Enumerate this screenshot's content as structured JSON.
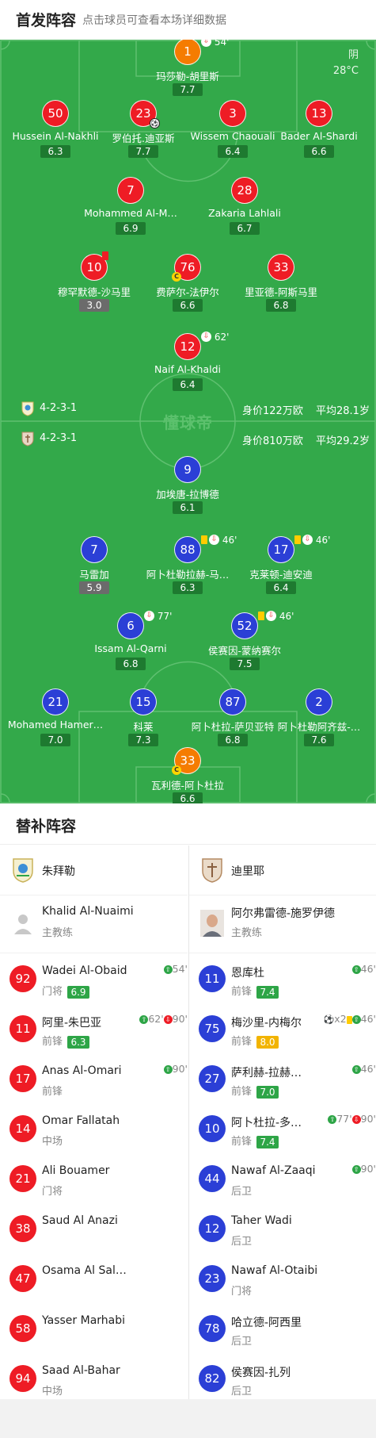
{
  "header": {
    "title": "首发阵容",
    "subtitle": "点击球员可查看本场详细数据"
  },
  "weather": {
    "condition": "阴",
    "temp": "28°C"
  },
  "watermark": "懂球帝",
  "home_team": {
    "formation": "4-2-3-1",
    "value": "身价122万欧",
    "age": "平均28.1岁"
  },
  "away_team": {
    "formation": "4-2-3-1",
    "value": "身价810万欧",
    "age": "平均29.2岁"
  },
  "home_players": [
    {
      "num": "1",
      "name": "玛莎勒-胡里斯",
      "rating": "7.7",
      "color": "orange",
      "sub": "54'"
    },
    {
      "num": "50",
      "name": "Hussein Al-Nakhli",
      "rating": "6.3",
      "color": "red"
    },
    {
      "num": "23",
      "name": "罗伯托.迪亚斯",
      "rating": "7.7",
      "color": "red",
      "goal": "⚽"
    },
    {
      "num": "3",
      "name": "Wissem Chaouali",
      "rating": "6.4",
      "color": "red"
    },
    {
      "num": "13",
      "name": "Bader Al-Shardi",
      "rating": "6.6",
      "color": "red"
    },
    {
      "num": "7",
      "name": "Mohammed Al-M…",
      "rating": "6.9",
      "color": "red"
    },
    {
      "num": "28",
      "name": "Zakaria Lahlali",
      "rating": "6.7",
      "color": "red"
    },
    {
      "num": "10",
      "name": "穆罕默德-沙马里",
      "rating": "3.0",
      "color": "red",
      "card": "red"
    },
    {
      "num": "76",
      "name": "费萨尔-法伊尔",
      "rating": "6.6",
      "color": "red",
      "captain": "C"
    },
    {
      "num": "33",
      "name": "里亚德-阿斯马里",
      "rating": "6.8",
      "color": "red"
    },
    {
      "num": "12",
      "name": "Naif Al-Khaldi",
      "rating": "6.4",
      "color": "red",
      "sub": "62'"
    }
  ],
  "away_players": [
    {
      "num": "9",
      "name": "加埃唐-拉博德",
      "rating": "6.1",
      "color": "blue"
    },
    {
      "num": "7",
      "name": "马雷加",
      "rating": "5.9",
      "color": "blue"
    },
    {
      "num": "88",
      "name": "阿卜杜勒拉赫-马…",
      "rating": "6.3",
      "color": "blue",
      "sub": "46'",
      "yellow": true
    },
    {
      "num": "17",
      "name": "克莱顿-迪安迪",
      "rating": "6.4",
      "color": "blue",
      "sub": "46'",
      "yellow": true
    },
    {
      "num": "6",
      "name": "Issam Al-Qarni",
      "rating": "6.8",
      "color": "blue",
      "sub": "77'"
    },
    {
      "num": "52",
      "name": "侯赛因-蒙纳赛尔",
      "rating": "7.5",
      "color": "blue",
      "sub": "46'",
      "yellow": true
    },
    {
      "num": "21",
      "name": "Mohamed Hamer…",
      "rating": "7.0",
      "color": "blue"
    },
    {
      "num": "15",
      "name": "科莱",
      "rating": "7.3",
      "color": "blue"
    },
    {
      "num": "87",
      "name": "阿卜杜拉-萨贝亚特",
      "rating": "6.8",
      "color": "blue"
    },
    {
      "num": "2",
      "name": "阿卜杜勒阿齐兹-…",
      "rating": "7.6",
      "color": "blue"
    },
    {
      "num": "33",
      "name": "瓦利德-阿卜杜拉",
      "rating": "6.6",
      "color": "orange",
      "captain": "C"
    }
  ],
  "subs_title": "替补阵容",
  "subs_left": {
    "team": "朱拜勒",
    "coach": {
      "name": "Khalid Al-Nuaimi",
      "role": "主教练"
    },
    "players": [
      {
        "num": "92",
        "name": "Wadei Al-Obaid",
        "pos": "门将",
        "rating": "6.9",
        "events": [
          {
            "t": "in",
            "v": "54'"
          }
        ]
      },
      {
        "num": "11",
        "name": "阿里-朱巴亚",
        "pos": "前锋",
        "rating": "6.3",
        "events": [
          {
            "t": "in",
            "v": "62'"
          },
          {
            "t": "out",
            "v": "90'"
          }
        ]
      },
      {
        "num": "17",
        "name": "Anas Al-Omari",
        "pos": "前锋",
        "events": [
          {
            "t": "in",
            "v": "90'"
          }
        ]
      },
      {
        "num": "14",
        "name": "Omar Fallatah",
        "pos": "中场",
        "events": []
      },
      {
        "num": "21",
        "name": "Ali Bouamer",
        "pos": "门将",
        "events": []
      },
      {
        "num": "38",
        "name": "Saud Al Anazi",
        "pos": "",
        "events": []
      },
      {
        "num": "47",
        "name": "Osama Al Sal…",
        "pos": "",
        "events": []
      },
      {
        "num": "58",
        "name": "Yasser Marhabi",
        "pos": "",
        "events": []
      },
      {
        "num": "94",
        "name": "Saad Al-Bahar",
        "pos": "中场",
        "events": []
      }
    ]
  },
  "subs_right": {
    "team": "迪里耶",
    "coach": {
      "name": "阿尔弗雷德-施罗伊德",
      "role": "主教练"
    },
    "players": [
      {
        "num": "11",
        "name": "恩库杜",
        "pos": "前锋",
        "rating": "7.4",
        "events": [
          {
            "t": "in",
            "v": "46'"
          }
        ]
      },
      {
        "num": "75",
        "name": "梅沙里-内梅尔",
        "pos": "前锋",
        "rating": "8.0",
        "ratingColor": "yellow",
        "events": [
          {
            "t": "goal",
            "v": "x2"
          },
          {
            "t": "yellow",
            "v": ""
          },
          {
            "t": "in",
            "v": "46'"
          }
        ]
      },
      {
        "num": "27",
        "name": "萨利赫-拉赫…",
        "pos": "前锋",
        "rating": "7.0",
        "events": [
          {
            "t": "in",
            "v": "46'"
          }
        ]
      },
      {
        "num": "10",
        "name": "阿卜杜拉-多…",
        "pos": "前锋",
        "rating": "7.4",
        "events": [
          {
            "t": "in",
            "v": "77'"
          },
          {
            "t": "out",
            "v": "90'"
          }
        ]
      },
      {
        "num": "44",
        "name": "Nawaf Al-Zaaqi",
        "pos": "后卫",
        "events": [
          {
            "t": "in",
            "v": "90'"
          }
        ]
      },
      {
        "num": "12",
        "name": "Taher Wadi",
        "pos": "后卫",
        "events": []
      },
      {
        "num": "23",
        "name": "Nawaf Al-Otaibi",
        "pos": "门将",
        "events": []
      },
      {
        "num": "78",
        "name": "哈立德-阿西里",
        "pos": "后卫",
        "events": []
      },
      {
        "num": "82",
        "name": "侯赛因-扎列",
        "pos": "后卫",
        "events": []
      }
    ]
  }
}
